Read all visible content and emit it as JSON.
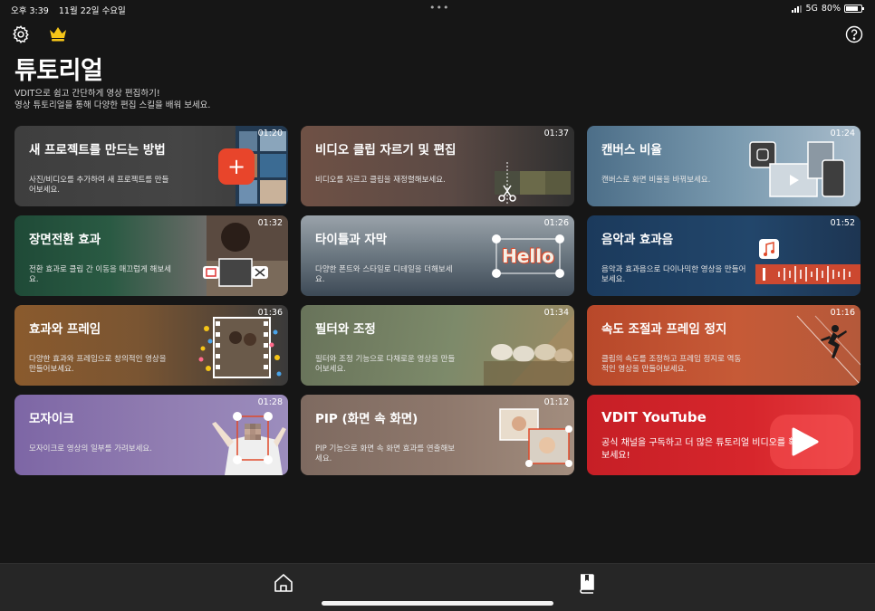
{
  "status_bar": {
    "time": "오후 3:39",
    "date": "11월 22일 수요일",
    "dots": "•••",
    "network": "5G",
    "battery_text": "80%",
    "battery_level": 0.8
  },
  "header": {
    "title": "튜토리얼",
    "subtitle_line1": "VDIT으로 쉽고 간단하게 영상 편집하기!",
    "subtitle_line2": "영상 튜토리얼을 통해 다양한 편집 스킬을 배워 보세요.",
    "settings_icon": "gear-icon",
    "crown_icon": "crown-icon",
    "help_icon": "question-circle-icon",
    "crown_color": "#f5c518"
  },
  "cards": [
    {
      "title": "새 프로젝트를 만드는 방법",
      "desc": "사진/비디오를 추가하여 새 프로젝트를 만들어보세요.",
      "duration": "01:20",
      "plus": "+"
    },
    {
      "title": "비디오 클립 자르기 및 편집",
      "desc": "비디오를 자르고 클립을 재정렬해보세요.",
      "duration": "01:37"
    },
    {
      "title": "캔버스 비율",
      "desc": "캔버스로 화면 비율을 바꿔보세요.",
      "duration": "01:24"
    },
    {
      "title": "장면전환 효과",
      "desc": "전환 효과로 클립 간 이동을 매끄럽게 해보세요.",
      "duration": "01:32"
    },
    {
      "title": "타이틀과 자막",
      "desc": "다양한 폰트와 스타일로 디테일을 더해보세요.",
      "duration": "01:26",
      "art_text": "Hello"
    },
    {
      "title": "음악과 효과음",
      "desc": "음악과 효과음으로 다이나믹한 영상을 만들어보세요.",
      "duration": "01:52"
    },
    {
      "title": "효과와 프레임",
      "desc": "다양한 효과와 프레임으로 창의적인 영상을 만들어보세요.",
      "duration": "01:36"
    },
    {
      "title": "필터와 조정",
      "desc": "필터와 조정 기능으로 다채로운 영상을 만들어보세요.",
      "duration": "01:34"
    },
    {
      "title": "속도 조절과 프레임 정지",
      "desc": "클립의 속도를 조정하고 프레임 정지로 역동적인 영상을 만들어보세요.",
      "duration": "01:16"
    },
    {
      "title": "모자이크",
      "desc": "모자이크로 영상의 일부를 가려보세요.",
      "duration": "01:28"
    },
    {
      "title": "PIP (화면 속 화면)",
      "desc": "PIP 기능으로 화면 속 화면 효과를 연출해보세요.",
      "duration": "01:12"
    },
    {
      "title": "VDIT YouTube",
      "desc": "공식 채널을 구독하고 더 많은 튜토리얼 비디오를 확인해 보세요!",
      "icon": "play-icon"
    }
  ],
  "bottom_nav": {
    "home_icon": "home-icon",
    "tutorial_icon": "book-icon"
  },
  "colors": {
    "background": "#161616",
    "accent_red": "#e8452b",
    "bottom_bar": "#262626"
  }
}
